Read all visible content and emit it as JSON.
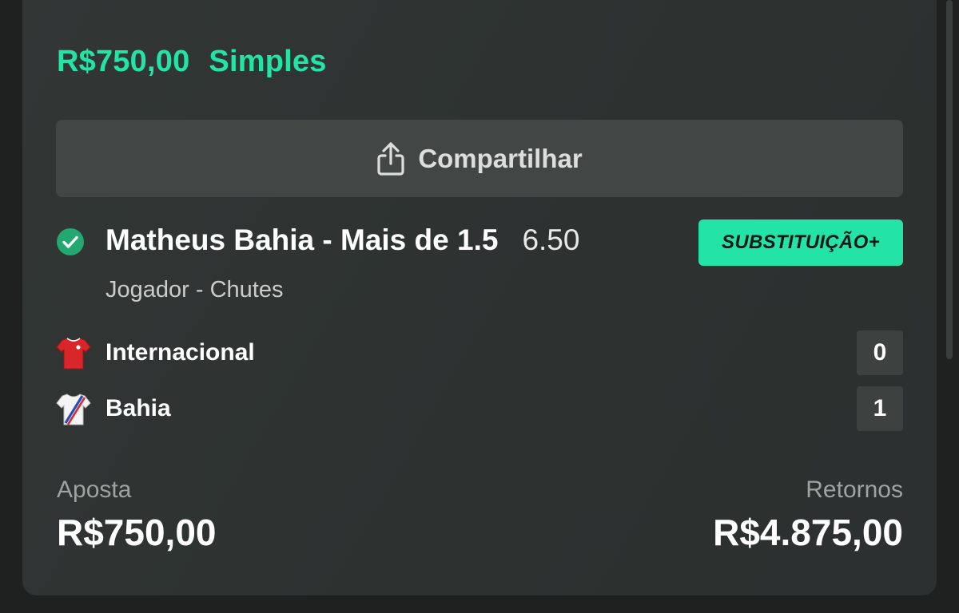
{
  "bet": {
    "stake_header": "R$750,00",
    "bet_type": "Simples"
  },
  "share_button": {
    "label": "Compartilhar",
    "icon": "share-icon"
  },
  "selection": {
    "name": "Matheus Bahia - Mais de 1.5",
    "odds": "6.50",
    "status_icon": "check-circle-icon",
    "badge": "SUBSTITUIÇÃO+",
    "market": "Jogador - Chutes"
  },
  "match": {
    "teams": [
      {
        "name": "Internacional",
        "score": "0",
        "icon": "red-jersey-icon"
      },
      {
        "name": "Bahia",
        "score": "1",
        "icon": "white-jersey-icon"
      }
    ]
  },
  "summary": {
    "stake_label": "Aposta",
    "stake_value": "R$750,00",
    "returns_label": "Retornos",
    "returns_value": "R$4.875,00"
  },
  "colors": {
    "accent": "#23e3a6",
    "card_bg": "#303534",
    "page_bg": "#1f2121"
  }
}
